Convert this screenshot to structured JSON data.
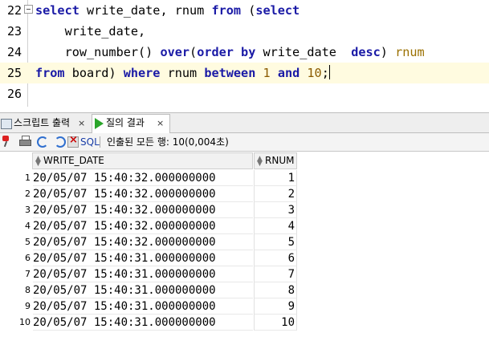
{
  "editor": {
    "lines": [
      {
        "num": "22",
        "fold": true,
        "tokens": [
          [
            "kw",
            "select"
          ],
          [
            "t",
            " write_date, rnum "
          ],
          [
            "kw",
            "from"
          ],
          [
            "t",
            " ("
          ],
          [
            "kw",
            "select"
          ]
        ]
      },
      {
        "num": "23",
        "fold": false,
        "tokens": [
          [
            "t",
            "    write_date,"
          ]
        ]
      },
      {
        "num": "24",
        "fold": false,
        "tokens": [
          [
            "t",
            "    row_number() "
          ],
          [
            "kw",
            "over"
          ],
          [
            "t",
            "("
          ],
          [
            "kw",
            "order by"
          ],
          [
            "t",
            " write_date  "
          ],
          [
            "kw",
            "desc"
          ],
          [
            "t",
            ") "
          ],
          [
            "alias",
            "rnum"
          ]
        ]
      },
      {
        "num": "25",
        "fold": false,
        "highlight": true,
        "caret": true,
        "tokens": [
          [
            "kw",
            "from"
          ],
          [
            "t",
            " board) "
          ],
          [
            "kw",
            "where"
          ],
          [
            "t",
            " rnum "
          ],
          [
            "kw",
            "between"
          ],
          [
            "t",
            " "
          ],
          [
            "num",
            "1"
          ],
          [
            "t",
            " "
          ],
          [
            "kw",
            "and"
          ],
          [
            "t",
            " "
          ],
          [
            "num",
            "10"
          ],
          [
            "t",
            ";"
          ]
        ]
      },
      {
        "num": "26",
        "fold": false,
        "tokens": []
      }
    ]
  },
  "tabs": {
    "script_output": "스크립트 출력",
    "query_result": "질의 결과",
    "close": "×"
  },
  "toolbar": {
    "sql_label": "SQL",
    "status": "인출된 모든 행: 10(0,004초)"
  },
  "grid": {
    "columns": [
      "WRITE_DATE",
      "RNUM"
    ],
    "rows": [
      {
        "n": "1",
        "write_date": "20/05/07 15:40:32.000000000",
        "rnum": "1"
      },
      {
        "n": "2",
        "write_date": "20/05/07 15:40:32.000000000",
        "rnum": "2"
      },
      {
        "n": "3",
        "write_date": "20/05/07 15:40:32.000000000",
        "rnum": "3"
      },
      {
        "n": "4",
        "write_date": "20/05/07 15:40:32.000000000",
        "rnum": "4"
      },
      {
        "n": "5",
        "write_date": "20/05/07 15:40:32.000000000",
        "rnum": "5"
      },
      {
        "n": "6",
        "write_date": "20/05/07 15:40:31.000000000",
        "rnum": "6"
      },
      {
        "n": "7",
        "write_date": "20/05/07 15:40:31.000000000",
        "rnum": "7"
      },
      {
        "n": "8",
        "write_date": "20/05/07 15:40:31.000000000",
        "rnum": "8"
      },
      {
        "n": "9",
        "write_date": "20/05/07 15:40:31.000000000",
        "rnum": "9"
      },
      {
        "n": "10",
        "write_date": "20/05/07 15:40:31.000000000",
        "rnum": "10"
      }
    ]
  },
  "icons": [
    "fold-icon",
    "script-output-icon",
    "query-result-icon",
    "pin-icon",
    "print-icon",
    "refresh-icon",
    "refresh-all-icon",
    "cancel-query-icon",
    "sort-icon"
  ]
}
